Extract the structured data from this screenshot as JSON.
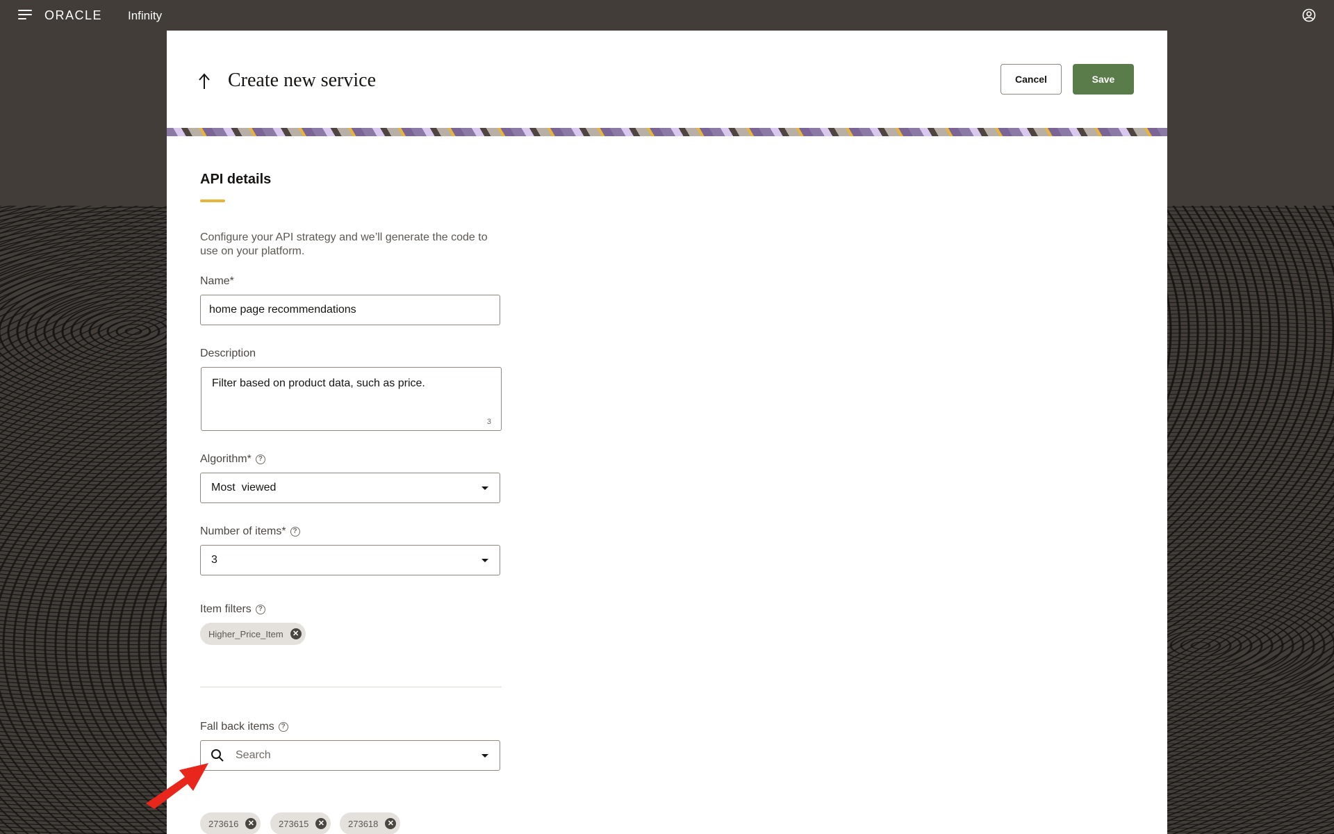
{
  "topbar": {
    "brand": "ORACLE",
    "product": "Infinity"
  },
  "header": {
    "title": "Create new service",
    "cancel_label": "Cancel",
    "save_label": "Save"
  },
  "section": {
    "title": "API details",
    "intro": "Configure your API strategy and we’ll generate the code to use on your platform."
  },
  "form": {
    "name_label": "Name*",
    "name_value": "home page recommendations",
    "description_label": "Description",
    "description_value": "Filter based on product data, such as price.",
    "description_count": "3",
    "algorithm_label": "Algorithm*",
    "algorithm_value": "Most  viewed",
    "items_label": "Number of items*",
    "items_value": "3",
    "filters_label": "Item filters",
    "filters": [
      "Higher_Price_Item"
    ],
    "fallback_label": "Fall back items",
    "fallback_placeholder": "Search",
    "fallback_items": [
      "273616",
      "273615",
      "273618"
    ]
  },
  "colors": {
    "topbar": "#423d38",
    "save": "#5a7b4a",
    "accent": "#e8b53c",
    "annotation_arrow": "#e8261c"
  },
  "icons": {
    "menu": "hamburger-icon",
    "back": "arrow-up-icon",
    "user": "user-circle-icon",
    "help": "question-circle-icon",
    "search": "search-icon",
    "remove": "close-circle-icon",
    "dropdown": "caret-down-icon"
  }
}
